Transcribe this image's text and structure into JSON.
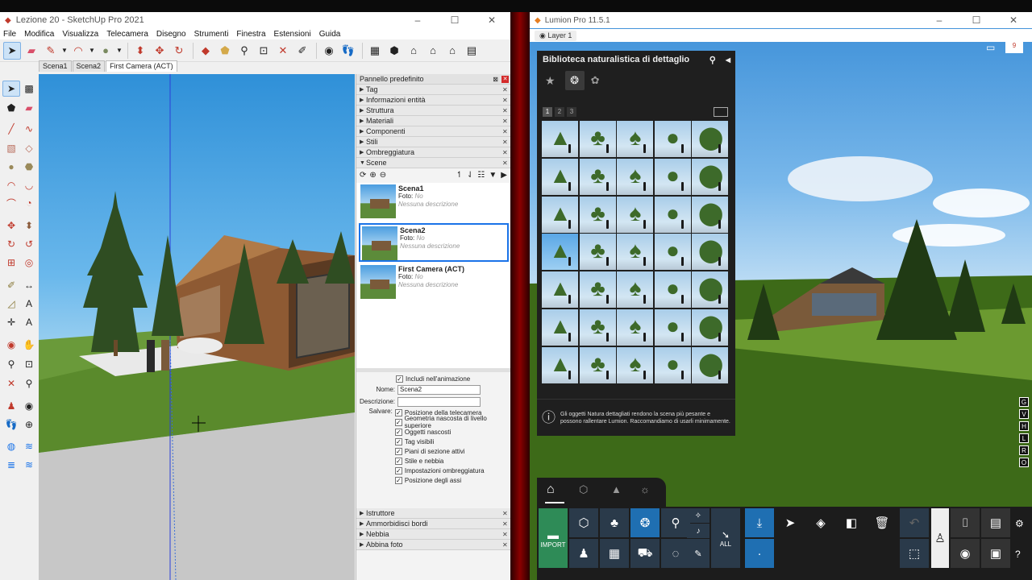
{
  "sketchup": {
    "window_title": "Lezione 20 - SketchUp Pro 2021",
    "menu": [
      "File",
      "Modifica",
      "Visualizza",
      "Telecamera",
      "Disegno",
      "Strumenti",
      "Finestra",
      "Estensioni",
      "Guida"
    ],
    "scene_tabs": [
      "Scena1",
      "Scena2",
      "First Camera (ACT)"
    ],
    "active_tab": 2,
    "panel_title": "Pannello predefinito",
    "panel_sections_top": [
      "Tag",
      "Informazioni entità",
      "Struttura",
      "Materiali",
      "Componenti",
      "Stili",
      "Ombreggiatura",
      "Scene"
    ],
    "scenes": [
      {
        "name": "Scena1",
        "foto": "Foto:",
        "foto_val": "No",
        "desc": "Nessuna descrizione"
      },
      {
        "name": "Scena2",
        "foto": "Foto:",
        "foto_val": "No",
        "desc": "Nessuna descrizione"
      },
      {
        "name": "First Camera (ACT)",
        "foto": "Foto:",
        "foto_val": "No",
        "desc": "Nessuna descrizione"
      }
    ],
    "selected_scene": 1,
    "include_animation": "Includi nell'animazione",
    "name_label": "Nome:",
    "name_value": "Scena2",
    "desc_label": "Descrizione:",
    "save_label": "Salvare:",
    "save_options": [
      "Posizione della telecamera",
      "Geometria nascosta di livello superiore",
      "Oggetti nascosti",
      "Tag visibili",
      "Piani di sezione attivi",
      "Stile e nebbia",
      "Impostazioni ombreggiatura",
      "Posizione degli assi"
    ],
    "panel_sections_bottom": [
      "Istruttore",
      "Ammorbidisci bordi",
      "Nebbia",
      "Abbina foto"
    ]
  },
  "lumion": {
    "window_title": "Lumion Pro 11.5.1",
    "layer_tab": "Layer 1",
    "library_title": "Biblioteca naturalistica di dettaglio",
    "pages": [
      "1",
      "2",
      "3"
    ],
    "info_text": "Gli oggetti Natura dettagliati rendono la scena più pesante e possono rallentare Lumion. Raccomandiamo di usarli minimamente.",
    "import_label": "IMPORT",
    "all_label": "ALL",
    "side_letters": [
      "G",
      "V",
      "H",
      "L",
      "R",
      "O"
    ],
    "badge": "9"
  },
  "colors": {
    "accent": "#1a73e8",
    "lumion_blue": "#1f6fb2",
    "lumion_green": "#2e8b57"
  }
}
